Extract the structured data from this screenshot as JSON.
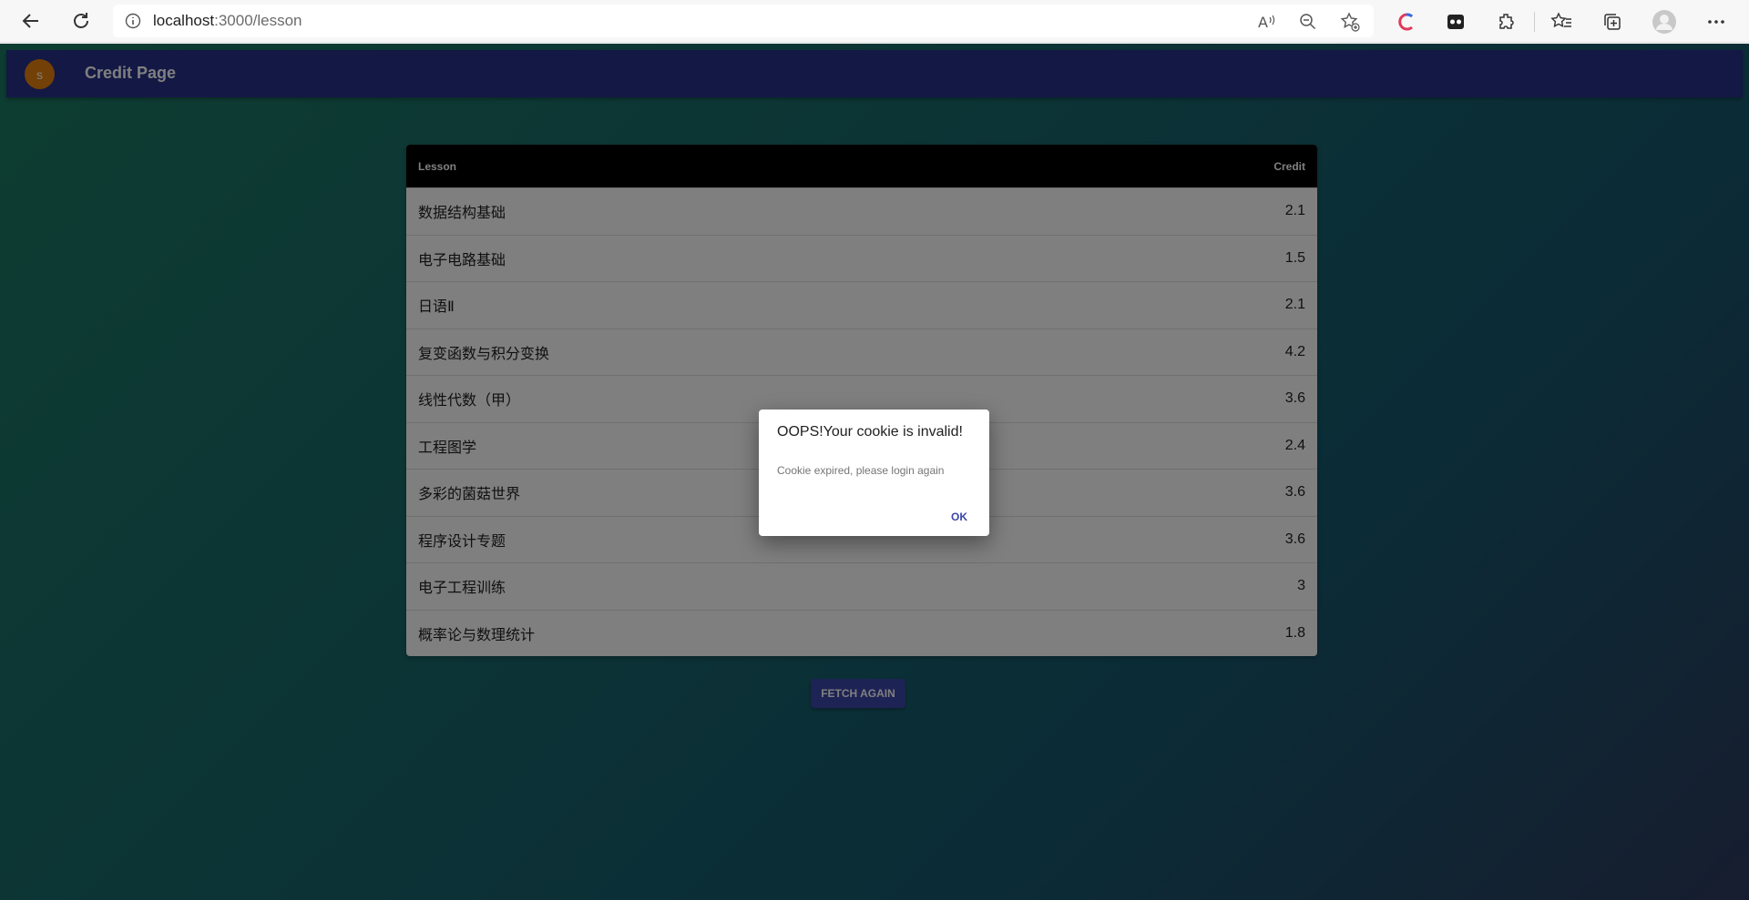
{
  "browser": {
    "url_host": "localhost",
    "url_path": ":3000/lesson"
  },
  "app": {
    "avatar_letter": "s",
    "title": "Credit Page"
  },
  "table": {
    "headers": [
      "Lesson",
      "Credit"
    ],
    "rows": [
      {
        "lesson": "数据结构基础",
        "credit": "2.1"
      },
      {
        "lesson": "电子电路基础",
        "credit": "1.5"
      },
      {
        "lesson": "日语Ⅱ",
        "credit": "2.1"
      },
      {
        "lesson": "复变函数与积分变换",
        "credit": "4.2"
      },
      {
        "lesson": "线性代数（甲）",
        "credit": "3.6"
      },
      {
        "lesson": "工程图学",
        "credit": "2.4"
      },
      {
        "lesson": "多彩的菌菇世界",
        "credit": "3.6"
      },
      {
        "lesson": "程序设计专题",
        "credit": "3.6"
      },
      {
        "lesson": "电子工程训练",
        "credit": "3"
      },
      {
        "lesson": "概率论与数理统计",
        "credit": "1.8"
      }
    ]
  },
  "fetch_button_label": "FETCH AGAIN",
  "dialog": {
    "title": "OOPS!Your cookie is invalid!",
    "message": "Cookie expired, please login again",
    "ok_label": "OK"
  },
  "colors": {
    "app_bar": "#27318a",
    "avatar": "#e6800e",
    "primary": "#3a46a8"
  }
}
